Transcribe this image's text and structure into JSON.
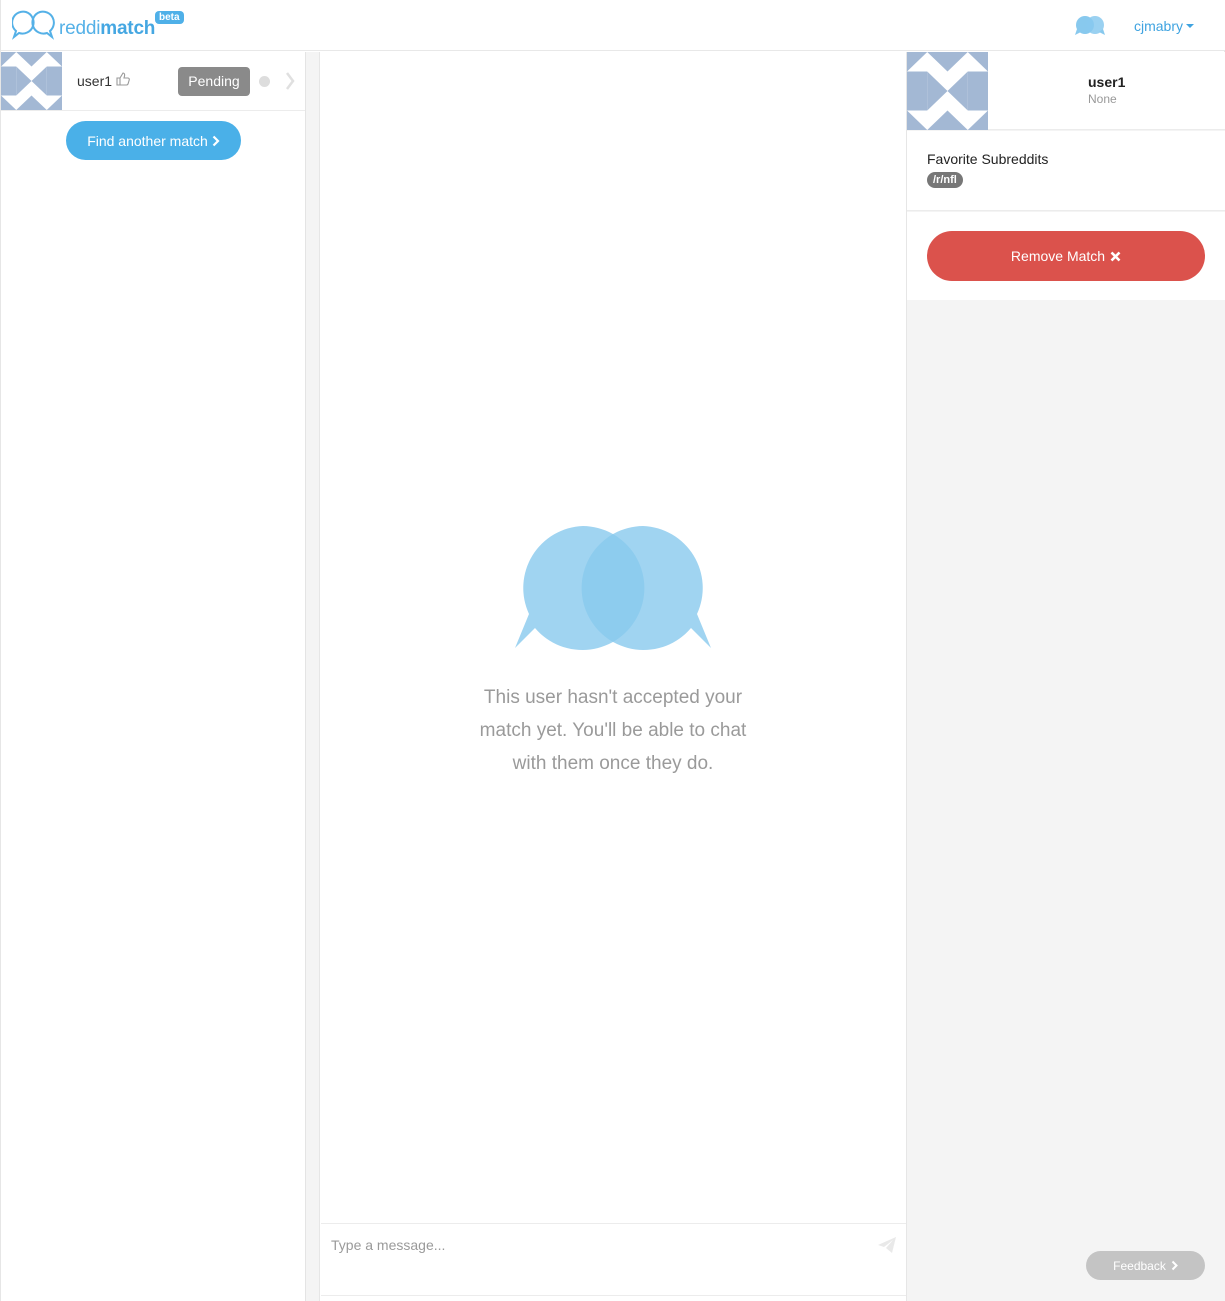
{
  "header": {
    "logo_text_light": "reddi",
    "logo_text_bold": "match",
    "beta_label": "beta",
    "username": "cjmabry",
    "logo_icon": "speech-bubbles-icon"
  },
  "matches": {
    "items": [
      {
        "name": "user1",
        "status": "Pending"
      }
    ],
    "find_button_label": "Find another match"
  },
  "chat": {
    "notice": "This user hasn't accepted your match yet. You'll be able to chat with them once they do.",
    "input_placeholder": "Type a message..."
  },
  "profile": {
    "name": "user1",
    "subtitle": "None",
    "favorites_title": "Favorite Subreddits",
    "subreddits": [
      "/r/nfl"
    ],
    "remove_button_label": "Remove Match",
    "feedback_label": "Feedback"
  },
  "colors": {
    "accent": "#4ab0e8",
    "danger": "#db524c",
    "pending": "#8a8a8a",
    "avatar": "#a3b8d4"
  }
}
